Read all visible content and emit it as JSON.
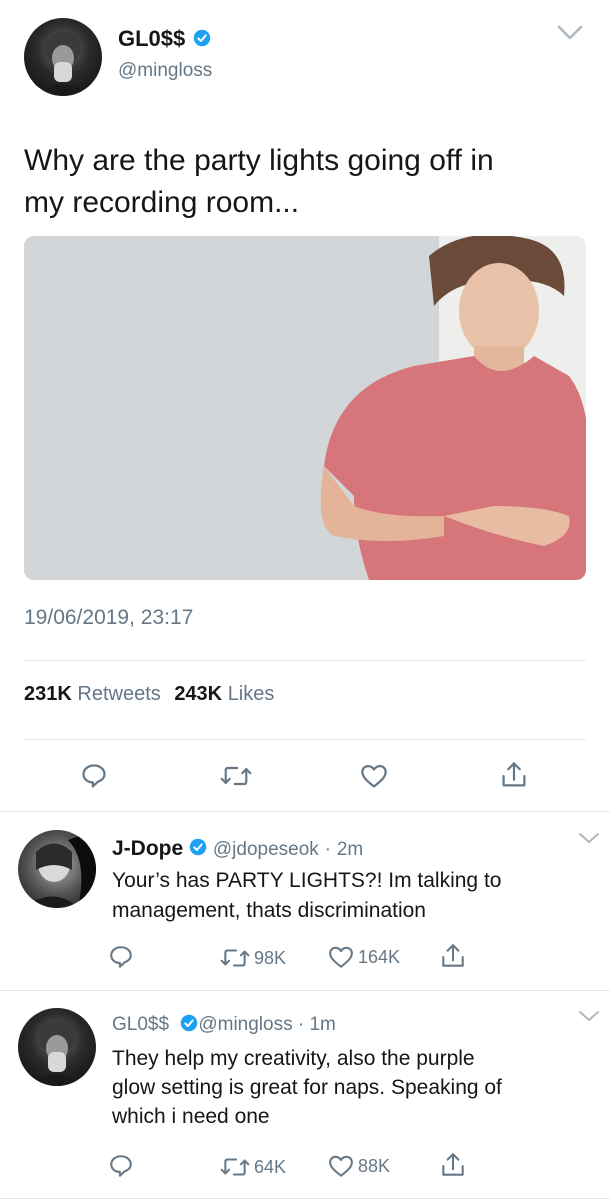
{
  "main_tweet": {
    "display_name": "GL0$$",
    "handle": "@mingloss",
    "text_line1": "Why are the party lights going off in",
    "text_line2": "my recording room...",
    "timestamp": "19/06/2019, 23:17",
    "retweets_count": "231K",
    "retweets_label": "Retweets",
    "likes_count": "243K",
    "likes_label": "Likes"
  },
  "replies": [
    {
      "display_name": "J-Dope",
      "handle": "@jdopeseok",
      "dot": "·",
      "time": "2m",
      "text_line1": "Your’s has PARTY LIGHTS?! Im talking to",
      "text_line2": "management, thats discrimination",
      "text_line3": "",
      "retweets": "98K",
      "likes": "164K"
    },
    {
      "display_name": "GL0$$",
      "handle": "@mingloss",
      "dot": "·",
      "time": "1m",
      "text_line1": "They help my creativity, also the purple",
      "text_line2": "glow setting is great for naps. Speaking of",
      "text_line3": "which i need one",
      "retweets": "64K",
      "likes": "88K"
    }
  ],
  "colors": {
    "verified": "#1da1f2",
    "text": "#14171a",
    "muted": "#657786",
    "divider": "#e1e8ed"
  },
  "icons": [
    "chevron-down-icon",
    "verified-icon",
    "reply-icon",
    "retweet-icon",
    "like-icon",
    "share-icon"
  ]
}
